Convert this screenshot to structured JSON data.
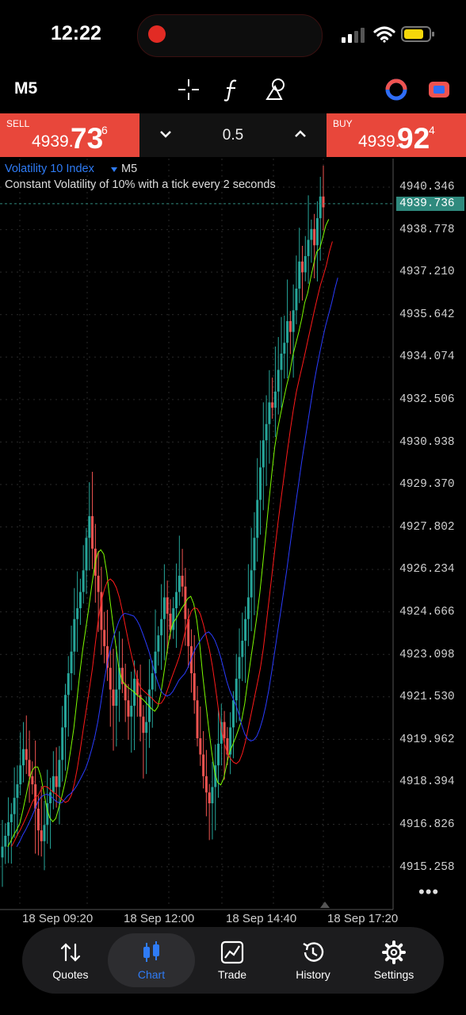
{
  "status_bar": {
    "time": "12:22"
  },
  "toolbar": {
    "timeframe": "M5"
  },
  "trade": {
    "sell_label": "SELL",
    "sell_small": "4939.",
    "sell_big": "73",
    "sell_sup": "6",
    "buy_label": "BUY",
    "buy_small": "4939.",
    "buy_big": "92",
    "buy_sup": "4",
    "volume": "0.5"
  },
  "chart_header": {
    "symbol": "Volatility 10 Index",
    "timeframe": "M5",
    "description": "Constant Volatility of 10% with a tick every 2 seconds"
  },
  "price_axis": {
    "current_price": "4939.736",
    "labels": [
      "4940.346",
      "4938.778",
      "4937.210",
      "4935.642",
      "4934.074",
      "4932.506",
      "4930.938",
      "4929.370",
      "4927.802",
      "4926.234",
      "4924.666",
      "4923.098",
      "4921.530",
      "4919.962",
      "4918.394",
      "4916.826",
      "4915.258"
    ]
  },
  "time_axis": {
    "labels": [
      "18 Sep 09:20",
      "18 Sep 12:00",
      "18 Sep 14:40",
      "18 Sep 17:20"
    ]
  },
  "more_label": "•••",
  "nav": {
    "items": [
      {
        "label": "Quotes"
      },
      {
        "label": "Chart"
      },
      {
        "label": "Trade"
      },
      {
        "label": "History"
      },
      {
        "label": "Settings"
      }
    ]
  },
  "colors": {
    "sell_bg": "#e8473b",
    "buy_bg": "#e8473b",
    "bull_candle": "#26a69a",
    "bear_candle": "#ef5350",
    "ma_fast": "#7cfc00",
    "ma_mid": "#ff1a1a",
    "ma_slow": "#2a3cff",
    "accent": "#2f7cf6"
  },
  "chart_data": {
    "type": "candlestick",
    "symbol": "Volatility 10 Index",
    "timeframe": "M5",
    "ylim": [
      4914.5,
      4941.0
    ],
    "x_tick_labels": [
      "18 Sep 09:20",
      "18 Sep 12:00",
      "18 Sep 14:40",
      "18 Sep 17:20"
    ],
    "grid": true,
    "close_path": [
      4916.0,
      4916.4,
      4916.9,
      4917.2,
      4917.8,
      4918.3,
      4919.0,
      4919.6,
      4919.2,
      4918.6,
      4918.3,
      4917.4,
      4916.6,
      4916.2,
      4916.8,
      4917.6,
      4918.0,
      4918.6,
      4918.2,
      4919.2,
      4920.4,
      4921.6,
      4922.4,
      4923.2,
      4924.4,
      4924.8,
      4925.4,
      4926.2,
      4927.4,
      4928.2,
      4927.0,
      4926.0,
      4925.4,
      4924.0,
      4923.4,
      4922.6,
      4921.8,
      4921.2,
      4921.8,
      4922.6,
      4922.0,
      4921.4,
      4920.8,
      4921.2,
      4922.2,
      4921.6,
      4920.8,
      4920.2,
      4920.6,
      4921.8,
      4922.4,
      4923.2,
      4923.8,
      4924.4,
      4925.2,
      4924.6,
      4924.0,
      4924.8,
      4925.4,
      4926.0,
      4925.6,
      4924.4,
      4923.4,
      4922.4,
      4921.4,
      4920.0,
      4919.4,
      4918.6,
      4918.0,
      4917.6,
      4918.2,
      4919.0,
      4919.8,
      4920.6,
      4920.0,
      4919.4,
      4920.4,
      4921.4,
      4922.2,
      4923.0,
      4923.6,
      4924.4,
      4925.2,
      4926.2,
      4927.4,
      4928.8,
      4930.0,
      4931.0,
      4931.6,
      4932.4,
      4932.2,
      4932.8,
      4933.6,
      4934.2,
      4934.6,
      4935.4,
      4935.0,
      4935.8,
      4936.6,
      4937.6,
      4937.2,
      4937.8,
      4938.4,
      4938.8,
      4938.2,
      4939.2,
      4940.0,
      4939.6
    ]
  }
}
